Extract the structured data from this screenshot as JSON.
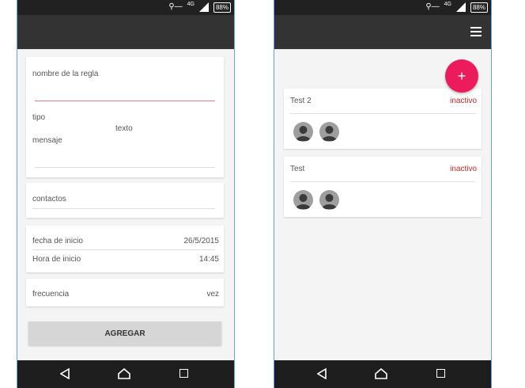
{
  "status_bar": {
    "network_label": "4G",
    "battery_label": "88%"
  },
  "left_screen": {
    "rule_name_label": "nombre de la regla",
    "type_label": "tipo",
    "type_value": "texto",
    "message_label": "mensaje",
    "contacts_label": "contactos",
    "start_date_label": "fecha de inicio",
    "start_date_value": "26/5/2015",
    "start_time_label": "Hora de inicio",
    "start_time_value": "14:45",
    "frequency_label": "frecuencia",
    "frequency_value": "vez",
    "add_button_label": "AGREGAR"
  },
  "right_screen": {
    "fab_label": "+",
    "rules": [
      {
        "name": "Test 2",
        "status": "inactivo"
      },
      {
        "name": "Test",
        "status": "inactivo"
      }
    ]
  },
  "colors": {
    "accent": "#ec1c5c",
    "status_inactive": "#c62828",
    "appbar": "#333333",
    "statusbar": "#212121"
  },
  "icons": [
    "key-icon",
    "signal-icon",
    "battery-icon",
    "menu-icon",
    "back-icon",
    "home-icon",
    "recents-icon",
    "avatar-icon"
  ]
}
